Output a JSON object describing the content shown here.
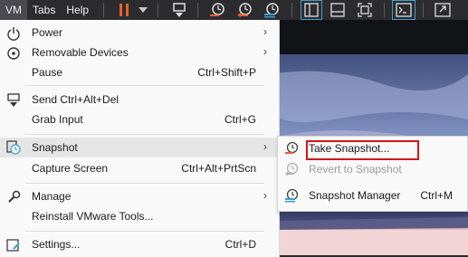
{
  "toolbar": {
    "menus": [
      "VM",
      "Tabs",
      "Help"
    ],
    "icons": [
      "pause-icon",
      "dropdown-arrow-icon",
      "send-keys-icon",
      "take-snapshot-icon",
      "revert-snapshot-icon",
      "snapshot-manager-icon",
      "sidebar-view-icon",
      "single-view-icon",
      "fit-guest-icon",
      "console-view-icon",
      "fullscreen-icon"
    ],
    "accent_color": "#e8602c"
  },
  "vm_menu": {
    "items": [
      {
        "label": "Power",
        "shortcut": "",
        "submenu": true,
        "icon": "power-icon"
      },
      {
        "label": "Removable Devices",
        "shortcut": "",
        "submenu": true,
        "icon": "removable-devices-icon"
      },
      {
        "label": "Pause",
        "shortcut": "Ctrl+Shift+P",
        "submenu": false,
        "icon": ""
      },
      {
        "label": "Send Ctrl+Alt+Del",
        "shortcut": "",
        "submenu": false,
        "icon": "send-keys-icon"
      },
      {
        "label": "Grab Input",
        "shortcut": "Ctrl+G",
        "submenu": false,
        "icon": ""
      },
      {
        "label": "Snapshot",
        "shortcut": "",
        "submenu": true,
        "icon": "snapshot-icon"
      },
      {
        "label": "Capture Screen",
        "shortcut": "Ctrl+Alt+PrtScn",
        "submenu": false,
        "icon": ""
      },
      {
        "label": "Manage",
        "shortcut": "",
        "submenu": true,
        "icon": "wrench-icon"
      },
      {
        "label": "Reinstall VMware Tools...",
        "shortcut": "",
        "submenu": false,
        "icon": ""
      },
      {
        "label": "Settings...",
        "shortcut": "Ctrl+D",
        "submenu": false,
        "icon": "settings-icon"
      }
    ]
  },
  "snapshot_submenu": {
    "items": [
      {
        "label": "Take Snapshot...",
        "shortcut": "",
        "enabled": true,
        "icon": "take-snapshot-icon"
      },
      {
        "label": "Revert to Snapshot",
        "shortcut": "",
        "enabled": false,
        "icon": "revert-snapshot-icon"
      },
      {
        "label": "Snapshot Manager",
        "shortcut": "Ctrl+M",
        "enabled": true,
        "icon": "snapshot-manager-icon"
      }
    ],
    "highlight_color": "#d01818"
  }
}
